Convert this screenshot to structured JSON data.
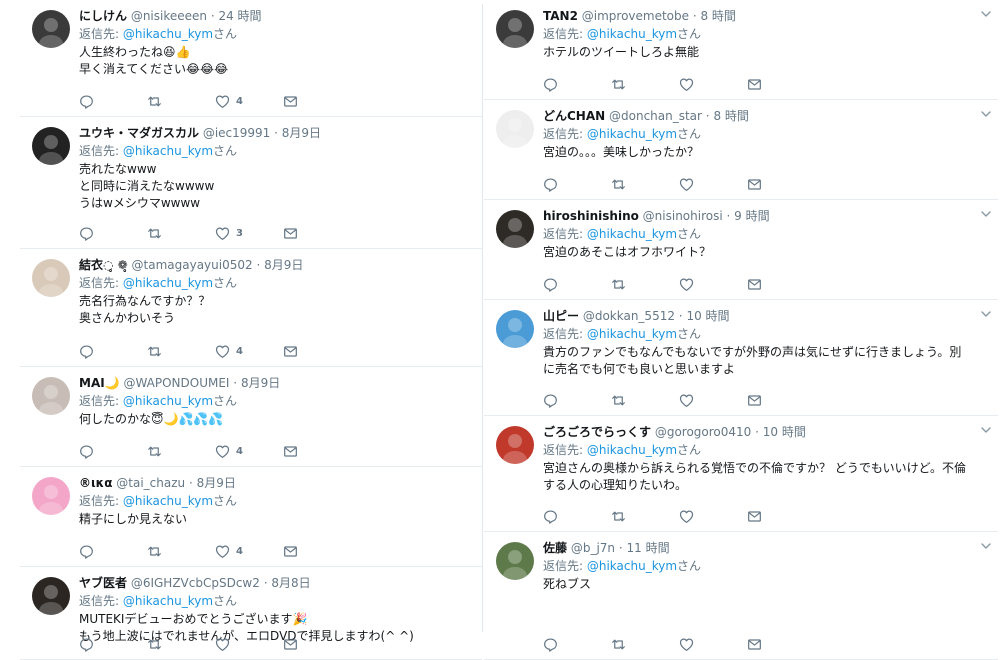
{
  "left_column": [
    {
      "name": "にしけん",
      "handle": "@nisikeeeen",
      "time": "24 時間",
      "reply_prefix": "返信先:",
      "reply_mention": "@hikachu_kym",
      "reply_suffix": "さん",
      "lines": [
        "人生終わったね😆👍",
        "早く消えてください😂😂😂"
      ],
      "likes": "4",
      "avatar_color": "#3a3a3a"
    },
    {
      "name": "ユウキ・マダガスカル",
      "handle": "@iec19991",
      "time": "8月9日",
      "reply_prefix": "返信先:",
      "reply_mention": "@hikachu_kym",
      "reply_suffix": "さん",
      "lines": [
        "売れたなwww",
        "と同時に消えたなwwww",
        "うはwメシウマwwww"
      ],
      "likes": "3",
      "avatar_color": "#222222"
    },
    {
      "name": "結衣◌̥ ❁̥",
      "handle": "@tamagayayui0502",
      "time": "8月9日",
      "reply_prefix": "返信先:",
      "reply_mention": "@hikachu_kym",
      "reply_suffix": "さん",
      "lines": [
        "売名行為なんですか？？",
        "奥さんかわいそう"
      ],
      "likes": "4",
      "avatar_color": "#d9c9b8"
    },
    {
      "name": "MAI🌙",
      "handle": "@WAPONDOUMEI",
      "time": "8月9日",
      "reply_prefix": "返信先:",
      "reply_mention": "@hikachu_kym",
      "reply_suffix": "さん",
      "lines": [
        "何したのかな😇🌙💦💦💦"
      ],
      "likes": "4",
      "avatar_color": "#c8bdb6"
    },
    {
      "name": "®ικα",
      "handle": "@tai_chazu",
      "time": "8月9日",
      "reply_prefix": "返信先:",
      "reply_mention": "@hikachu_kym",
      "reply_suffix": "さん",
      "lines": [
        "精子にしか見えない"
      ],
      "likes": "4",
      "avatar_color": "#f3a6c8"
    },
    {
      "name": "ヤブ医者",
      "handle": "@6IGHZVcbCpSDcw2",
      "time": "8月8日",
      "reply_prefix": "返信先:",
      "reply_mention": "@hikachu_kym",
      "reply_suffix": "さん",
      "lines": [
        "MUTEKIデビューおめでとうございます🎉",
        "もう地上波にはでれませんが、エロDVDで拝見しますわ(^ ^)"
      ],
      "likes": "",
      "avatar_color": "#2b2622"
    }
  ],
  "right_column": [
    {
      "name": "TAN2",
      "handle": "@improvemetobe",
      "time": "8 時間",
      "reply_prefix": "返信先:",
      "reply_mention": "@hikachu_kym",
      "reply_suffix": "さん",
      "lines": [
        "ホテルのツイートしろよ無能"
      ],
      "likes": "",
      "avatar_color": "#3b3b3b"
    },
    {
      "name": "どんCHAN",
      "handle": "@donchan_star",
      "time": "8 時間",
      "reply_prefix": "返信先:",
      "reply_mention": "@hikachu_kym",
      "reply_suffix": "さん",
      "lines": [
        "宮迫の。。。美味しかったか？"
      ],
      "likes": "",
      "avatar_color": "#eeeeee"
    },
    {
      "name": "hiroshinishino",
      "handle": "@nisinohirosi",
      "time": "9 時間",
      "reply_prefix": "返信先:",
      "reply_mention": "@hikachu_kym",
      "reply_suffix": "さん",
      "lines": [
        "宮迫のあそこはオフホワイト？"
      ],
      "likes": "",
      "avatar_color": "#2e2a26"
    },
    {
      "name": "山ピー",
      "handle": "@dokkan_5512",
      "time": "10 時間",
      "reply_prefix": "返信先:",
      "reply_mention": "@hikachu_kym",
      "reply_suffix": "さん",
      "lines": [
        "貴方のファンでもなんでもないですが外野の声は気にせずに行きましょう。別",
        "に売名でも何でも良いと思いますよ"
      ],
      "likes": "",
      "avatar_color": "#4a9bd6"
    },
    {
      "name": "ごろごろでらっくす",
      "handle": "@gorogoro0410",
      "time": "10 時間",
      "reply_prefix": "返信先:",
      "reply_mention": "@hikachu_kym",
      "reply_suffix": "さん",
      "lines": [
        "宮迫さんの奥様から訴えられる覚悟での不倫ですか？ どうでもいいけど。不倫",
        "する人の心理知りたいわ。"
      ],
      "likes": "",
      "avatar_color": "#c0392b"
    },
    {
      "name": "佐藤",
      "handle": "@b_j7n",
      "time": "11 時間",
      "reply_prefix": "返信先:",
      "reply_mention": "@hikachu_kym",
      "reply_suffix": "さん",
      "lines": [
        "死ねブス"
      ],
      "likes": "",
      "avatar_color": "#5e7a4a"
    }
  ],
  "icons": {
    "reply": "reply-icon",
    "retweet": "retweet-icon",
    "like": "heart-icon",
    "dm": "mail-icon",
    "menu": "chevron-down-icon"
  },
  "colors": {
    "link": "#1b95e0",
    "secondary": "#657786",
    "border": "#e6ecf0"
  }
}
